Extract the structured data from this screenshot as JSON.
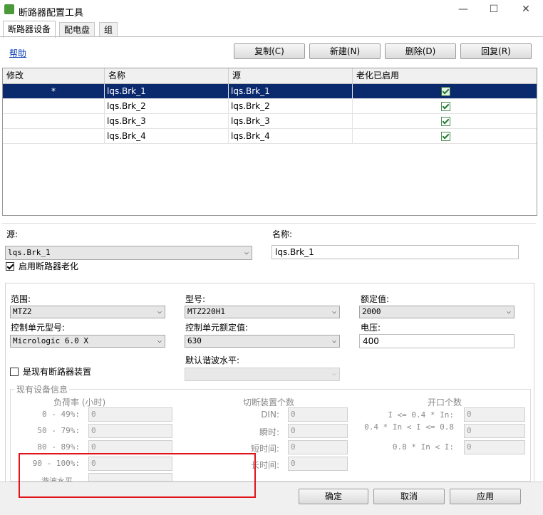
{
  "window": {
    "title": "断路器配置工具",
    "minimize": "—",
    "maximize": "☐",
    "close": "✕"
  },
  "tabs": [
    "断路器设备",
    "配电盘",
    "组"
  ],
  "help_link": "帮助",
  "toolbar": {
    "copy": "复制(C)",
    "new": "新建(N)",
    "delete": "删除(D)",
    "restore": "回复(R)"
  },
  "table": {
    "columns": [
      "修改",
      "名称",
      "源",
      "老化已启用"
    ],
    "rows": [
      {
        "modified": "*",
        "name": "lqs.Brk_1",
        "source": "lqs.Brk_1",
        "aging": true
      },
      {
        "modified": "",
        "name": "lqs.Brk_2",
        "source": "lqs.Brk_2",
        "aging": true
      },
      {
        "modified": "",
        "name": "lqs.Brk_3",
        "source": "lqs.Brk_3",
        "aging": true
      },
      {
        "modified": "",
        "name": "lqs.Brk_4",
        "source": "lqs.Brk_4",
        "aging": true
      }
    ]
  },
  "detail": {
    "source_label": "源:",
    "source_value": "lqs.Brk_1",
    "name_label": "名称:",
    "name_value": "lqs.Brk_1",
    "enable_aging": "启用断路器老化",
    "range_label": "范围:",
    "range_value": "MTZ2",
    "model_label": "型号:",
    "model_value": "MTZ220H1",
    "rated_label": "额定值:",
    "rated_value": "2000",
    "ctrl_model_label": "控制单元型号:",
    "ctrl_model_value": "Micrologic 6.0 X",
    "ctrl_rated_label": "控制单元额定值:",
    "ctrl_rated_value": "630",
    "voltage_label": "电压:",
    "voltage_value": "400",
    "harmonic_label": "默认谐波水平:",
    "harmonic_value": "",
    "existing_label": "是现有断路器装置",
    "existing_info": "现有设备信息"
  },
  "existing": {
    "load_title": "负荷率 (小时)",
    "load_rows": [
      {
        "label": "0 - 49%:",
        "value": "0"
      },
      {
        "label": "50 - 79%:",
        "value": "0"
      },
      {
        "label": "80 - 89%:",
        "value": "0"
      },
      {
        "label": "90 - 100%:",
        "value": "0"
      }
    ],
    "trip_title": "切断装置个数",
    "trip_rows": [
      {
        "label": "DIN:",
        "value": "0"
      },
      {
        "label": "瞬时:",
        "value": "0"
      },
      {
        "label": "短时间:",
        "value": "0"
      },
      {
        "label": "长时间:",
        "value": "0"
      }
    ],
    "open_title": "开口个数",
    "open_rows": [
      {
        "label": "I <= 0.4 * In:",
        "value": "0"
      },
      {
        "label": "0.4 * In < I <= 0.8",
        "value": "0"
      },
      {
        "label": "0.8 * In < I:",
        "value": "0"
      }
    ],
    "cut_label": "谐波水平"
  },
  "footer": {
    "ok": "确定",
    "cancel": "取消",
    "apply": "应用"
  },
  "colors": {
    "selection": "#0b2a6e",
    "highlight": "#e0141a"
  }
}
